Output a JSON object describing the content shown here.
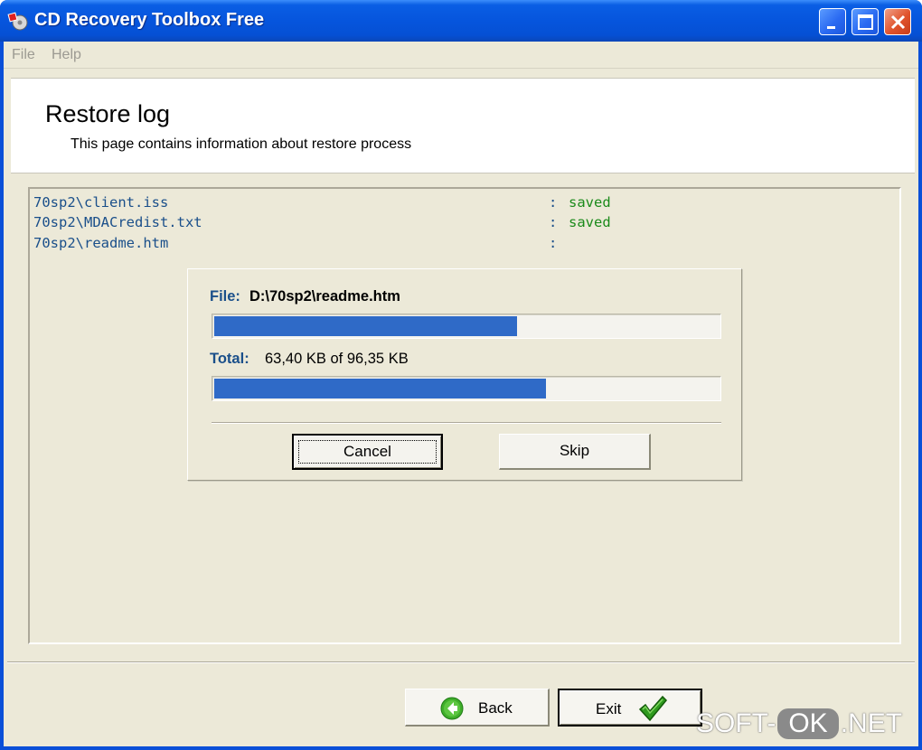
{
  "window": {
    "title": "CD Recovery Toolbox Free",
    "accent_color": "#0655dd",
    "controls": [
      "minimize-icon",
      "maximize-icon",
      "close-icon"
    ]
  },
  "menu": {
    "items": [
      {
        "label": "File"
      },
      {
        "label": "Help"
      }
    ]
  },
  "header": {
    "title": "Restore log",
    "subtitle": "This page contains information about restore process"
  },
  "log": {
    "entries": [
      {
        "path": "70sp2\\client.iss",
        "separator": ":",
        "status": "saved"
      },
      {
        "path": "70sp2\\MDACredist.txt",
        "separator": ":",
        "status": "saved"
      },
      {
        "path": "70sp2\\readme.htm",
        "separator": ":",
        "status": ""
      }
    ],
    "status_color": "#1b8a1b",
    "path_color": "#1a4f8a"
  },
  "progress": {
    "file_label": "File:",
    "file_value": "D:\\70sp2\\readme.htm",
    "file_progress": 0.6,
    "total_label": "Total:",
    "total_value": "63,40 KB of 96,35 KB",
    "total_progress": 0.658,
    "bar_color": "#2f6ac7",
    "cancel_label": "Cancel",
    "skip_label": "Skip"
  },
  "footer": {
    "back_label": "Back",
    "exit_label": "Exit",
    "back_icon": "back-arrow-icon",
    "exit_icon": "checkmark-icon"
  },
  "watermark": {
    "left": "SOFT-",
    "badge": "OK",
    "right": ".NET"
  }
}
